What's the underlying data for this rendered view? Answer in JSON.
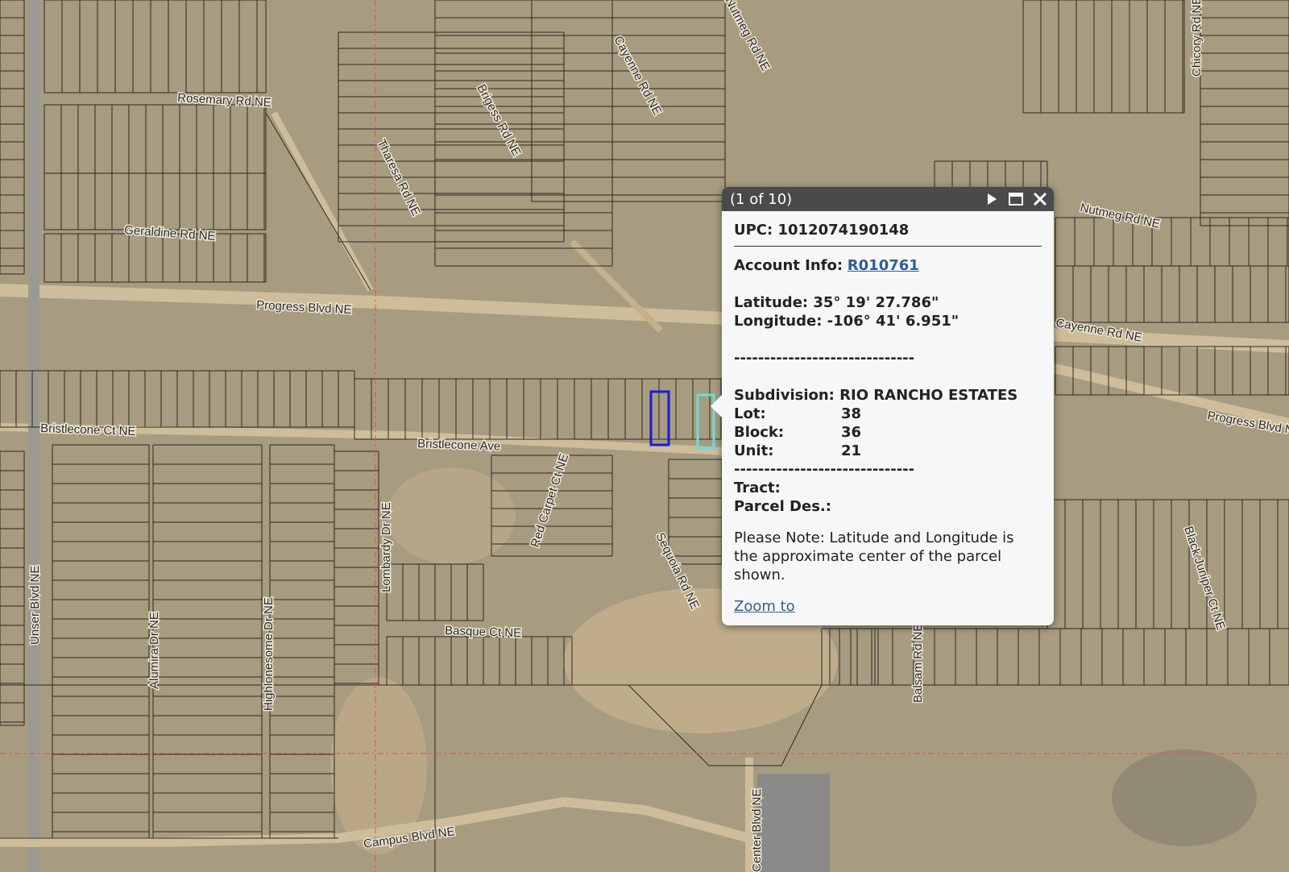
{
  "map": {
    "road_labels": [
      "Rosemary Rd NE",
      "Geraldine Rd NE",
      "Progress Blvd NE",
      "Progress Blvd NE",
      "Bristlecone Ct NE",
      "Bristlecone Ave",
      "Unser Blvd NE",
      "Alumira Dr NE",
      "Highlonesome Dr NE",
      "Lombardy Dr NE",
      "Red Carpet Ct NE",
      "Sequoia Rd NE",
      "Basque Ct NE",
      "Campus Blvd NE",
      "Center Blvd NE",
      "Tharesa Rd NE",
      "Brigess Rd NE",
      "Cayenne Rd NE",
      "Nutmeg Rd NE",
      "Nutmeg Rd NE",
      "Cayenne Rd NE",
      "Chicory Rd NE",
      "Black Juniper Ct NE",
      "Balsam Rd NE"
    ],
    "colors": {
      "ground": "#a79b80",
      "parcel_line": "#2e2a22",
      "road": "#cdbd9a",
      "selected_parcel": "#1a1ad6",
      "adjacent_parcel": "#64e0e0",
      "guide_line": "#e0504a"
    }
  },
  "popup": {
    "title": "(1 of 10)",
    "upc": "UPC: 1012074190148",
    "account_label": "Account Info:",
    "account_link": "R010761",
    "latitude": "Latitude: 35° 19' 27.786\"",
    "longitude": "Longitude: -106° 41' 6.951\"",
    "divider1": "------------------------------",
    "subdivision_label": "Subdivision:",
    "subdivision_value": "RIO RANCHO ESTATES",
    "lot_label": "Lot:",
    "lot_value": "38",
    "block_label": "Block:",
    "block_value": "36",
    "unit_label": "Unit:",
    "unit_value": "21",
    "divider2": "------------------------------",
    "tract_label": "Tract:",
    "parcel_des_label": "Parcel Des.:",
    "note": "Please Note: Latitude and Longitude is the approximate center of the parcel shown.",
    "zoom_link": "Zoom to",
    "icons": [
      "play-icon",
      "maximize-icon",
      "close-icon"
    ]
  }
}
